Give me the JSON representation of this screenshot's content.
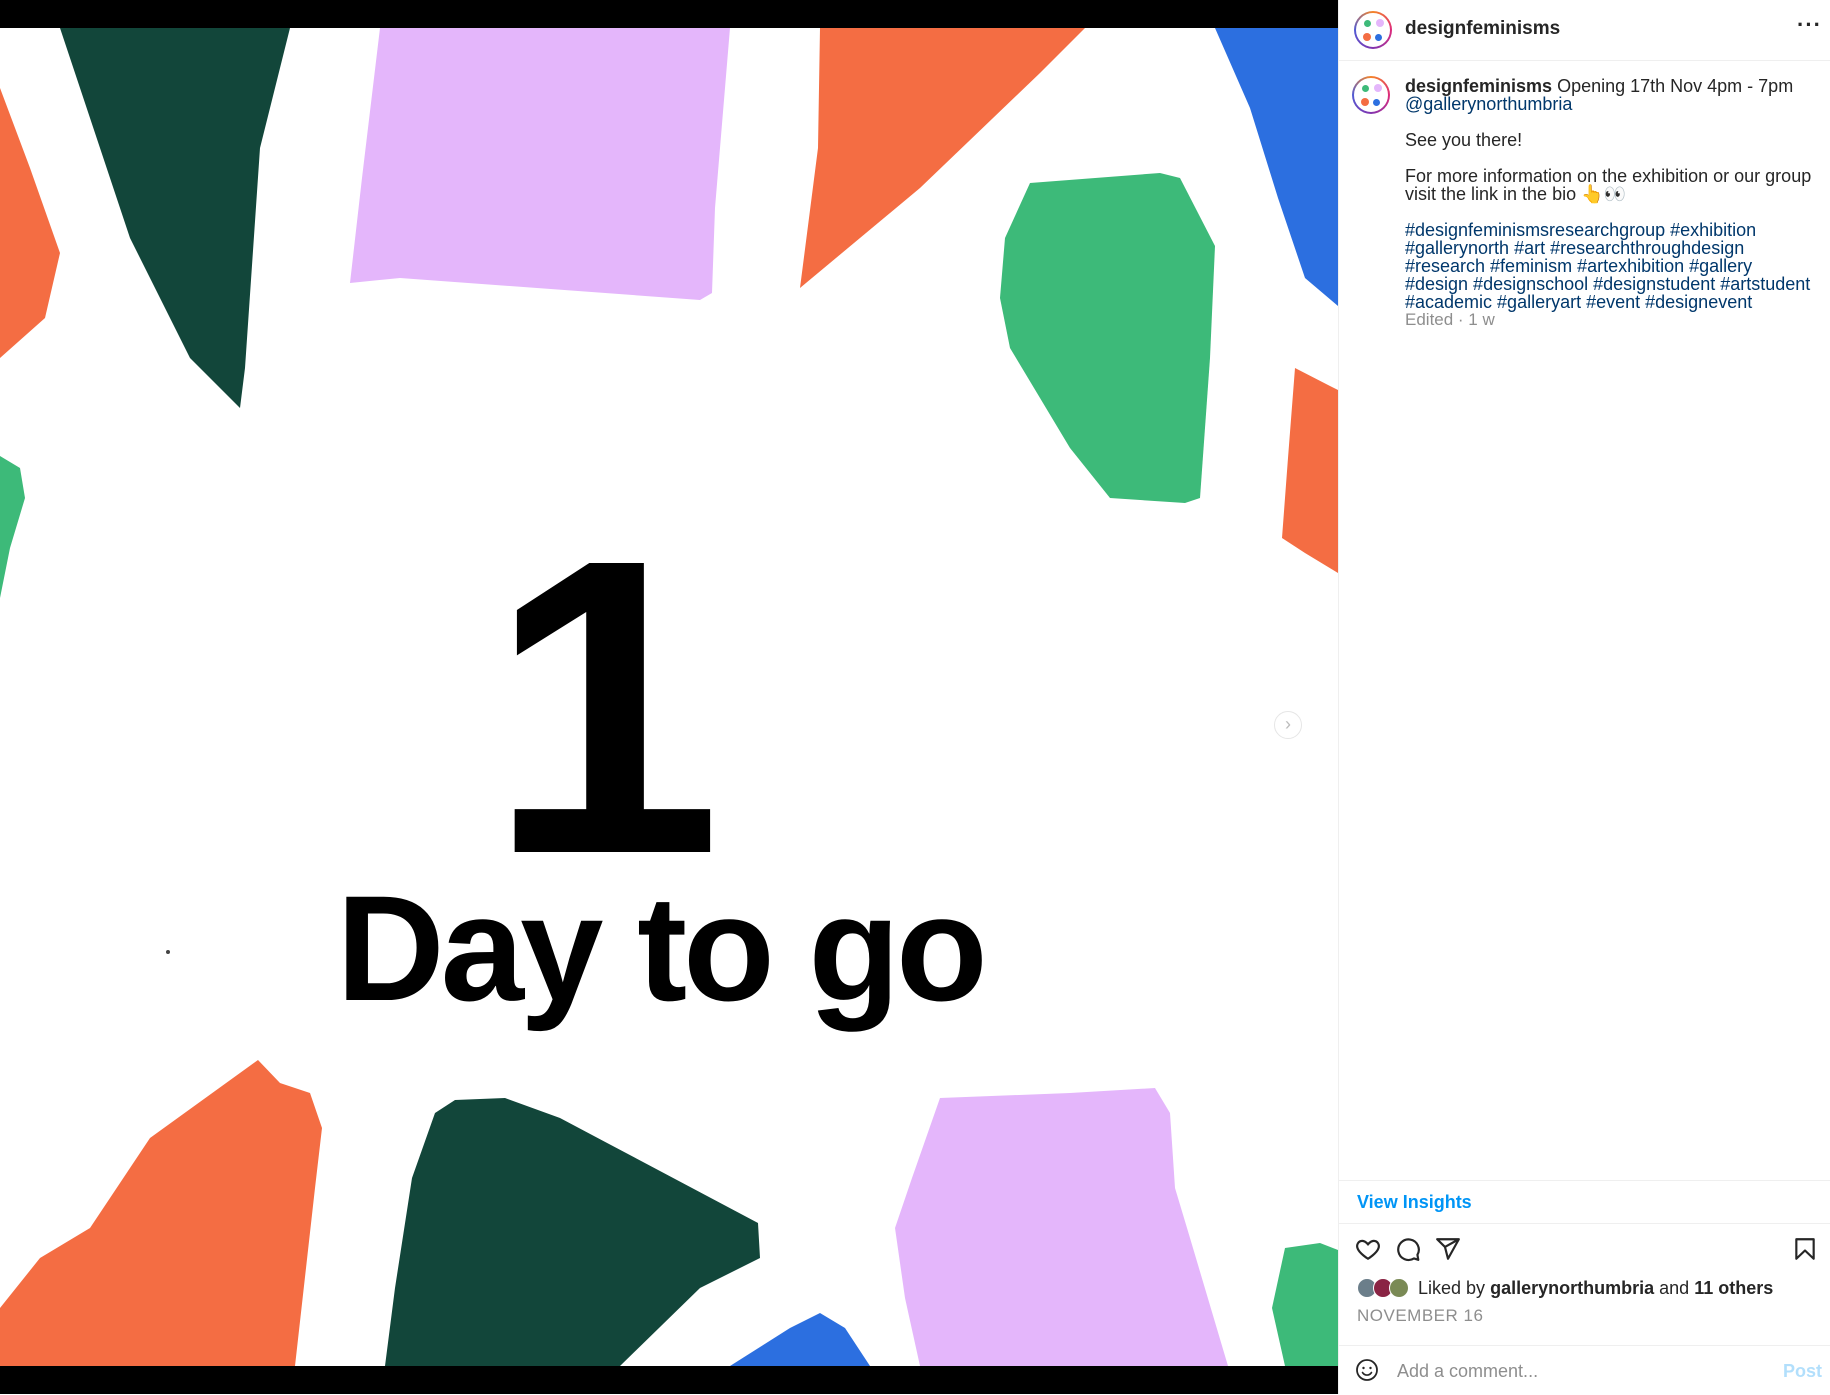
{
  "post": {
    "slide_number": "1",
    "slide_text": "Day to go"
  },
  "header": {
    "username": "designfeminisms",
    "more_label": "···"
  },
  "caption": {
    "username": "designfeminisms",
    "line1": "Opening 17th Nov 4pm - 7pm",
    "mention": "@gallerynorthumbria",
    "line2": "See you there!",
    "line3": "For more information on the exhibition or our group visit the link in the bio 👆👀",
    "hashtags": "#designfeminismsresearchgroup #exhibition #gallerynorth #art #researchthroughdesign #research #feminism #artexhibition #gallery #design #designschool #designstudent #artstudent #academic #galleryart #event #designevent",
    "edited": "Edited · 1 w"
  },
  "insights_label": "View Insights",
  "likes": {
    "prefix": "Liked by",
    "user": "gallerynorthumbria",
    "joiner": "and",
    "others": "11 others"
  },
  "date": "NOVEMBER 16",
  "comment": {
    "placeholder": "Add a comment...",
    "post_label": "Post"
  },
  "colors": {
    "orange": "#F46D43",
    "dark_green": "#12463A",
    "lilac": "#E4B6FB",
    "green": "#3DBA79",
    "blue": "#2C6FE0",
    "link": "#00376b",
    "accent": "#0095f6"
  },
  "icons": [
    "heart-icon",
    "comment-icon",
    "share-icon",
    "bookmark-icon",
    "emoji-icon",
    "chevron-right-icon",
    "more-icon"
  ]
}
